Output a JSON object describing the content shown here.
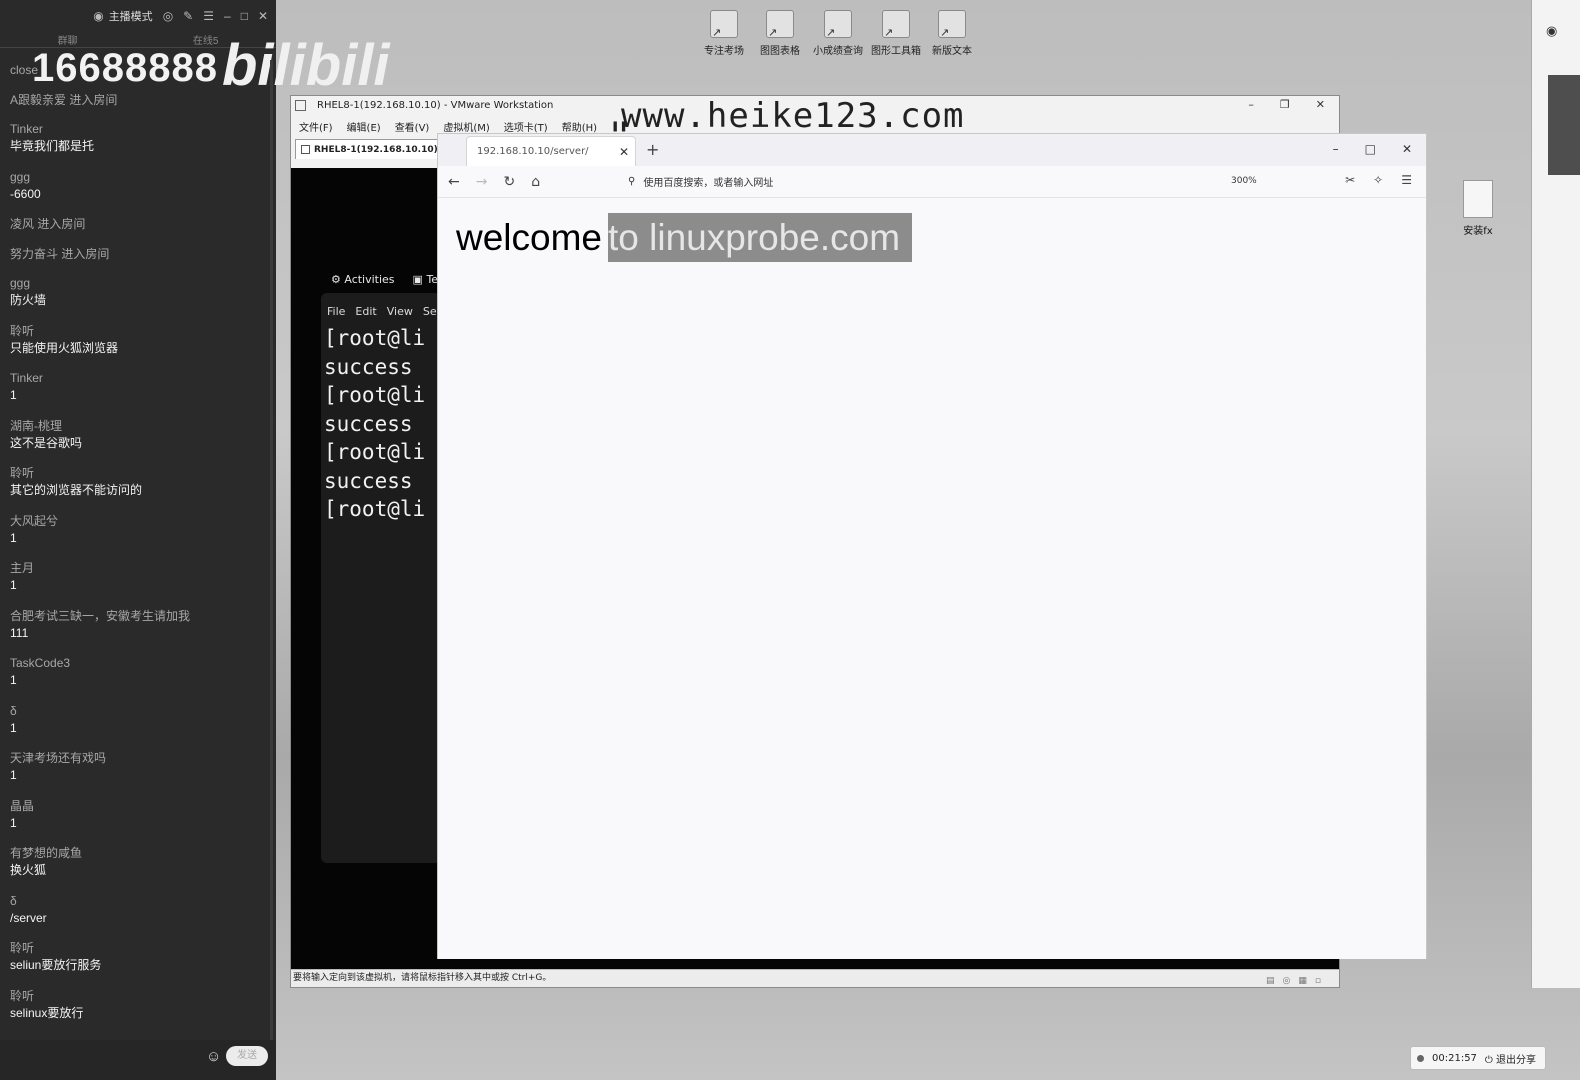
{
  "chat": {
    "mode_label": "主播模式",
    "tabs": [
      "群聊",
      "在线5"
    ],
    "overlay_number": "16688888",
    "brand": "bilibili",
    "first_line": "close",
    "messages": [
      {
        "user": "A跟毅亲爱",
        "text": "进入房间",
        "inline": true
      },
      {
        "user": "Tinker",
        "text": "毕竟我们都是托"
      },
      {
        "user": "ggg",
        "text": "-6600"
      },
      {
        "user": "凌风",
        "text": "进入房间",
        "inline": true
      },
      {
        "user": "努力奋斗",
        "text": "进入房间",
        "inline": true
      },
      {
        "user": "ggg",
        "text": "防火墙"
      },
      {
        "user": "聆听",
        "text": "只能使用火狐浏览器"
      },
      {
        "user": "Tinker",
        "text": "1"
      },
      {
        "user": "湖南-桃理",
        "text": "这不是谷歌吗"
      },
      {
        "user": "聆听",
        "text": "其它的浏览器不能访问的"
      },
      {
        "user": "大风起兮",
        "text": "1"
      },
      {
        "user": "主月",
        "text": "1"
      },
      {
        "user": "合肥考试三缺一，安徽考生请加我",
        "text": "111"
      },
      {
        "user": "TaskCode3",
        "text": "1"
      },
      {
        "user": "δ",
        "text": "1"
      },
      {
        "user": "天津考场还有戏吗",
        "text": "1"
      },
      {
        "user": "晶晶",
        "text": "1"
      },
      {
        "user": "有梦想的咸鱼",
        "text": "换火狐"
      },
      {
        "user": "δ",
        "text": "/server"
      },
      {
        "user": "聆听",
        "text": "seliun要放行服务"
      },
      {
        "user": "聆听",
        "text": "selinux要放行"
      }
    ],
    "send_label": "发送"
  },
  "desktop": {
    "icons": [
      "专注考场",
      "图图表格",
      "小成绩查询",
      "图形工具箱",
      "新版文本"
    ],
    "file_label": "安装fx"
  },
  "vmware": {
    "title": "RHEL8-1(192.168.10.10) - VMware Workstation",
    "menu": [
      "文件(F)",
      "编辑(E)",
      "查看(V)",
      "虚拟机(M)",
      "选项卡(T)",
      "帮助(H)"
    ],
    "watermark": "www.heike123.com",
    "tab_label": "RHEL8-1(192.168.10.10)",
    "status_text": "要将输入定向到该虚拟机，请将鼠标指针移入其中或按 Ctrl+G。",
    "gnome": {
      "activities": "Activities",
      "terminal": "Te"
    },
    "terminal_menu": [
      "File",
      "Edit",
      "View",
      "Se"
    ],
    "terminal_lines": [
      "[root@li",
      "success",
      "[root@li",
      "success",
      "[root@li",
      "success",
      "[root@li"
    ]
  },
  "firefox": {
    "tab_title": "192.168.10.10/server/",
    "url_placeholder": "使用百度搜索，或者输入网址",
    "zoom": "300%",
    "page_text_plain": "welcome",
    "page_text_selected": "to linuxprobe.com"
  },
  "sharebar": {
    "time": "00:21:57",
    "exit_label": "退出分享"
  }
}
